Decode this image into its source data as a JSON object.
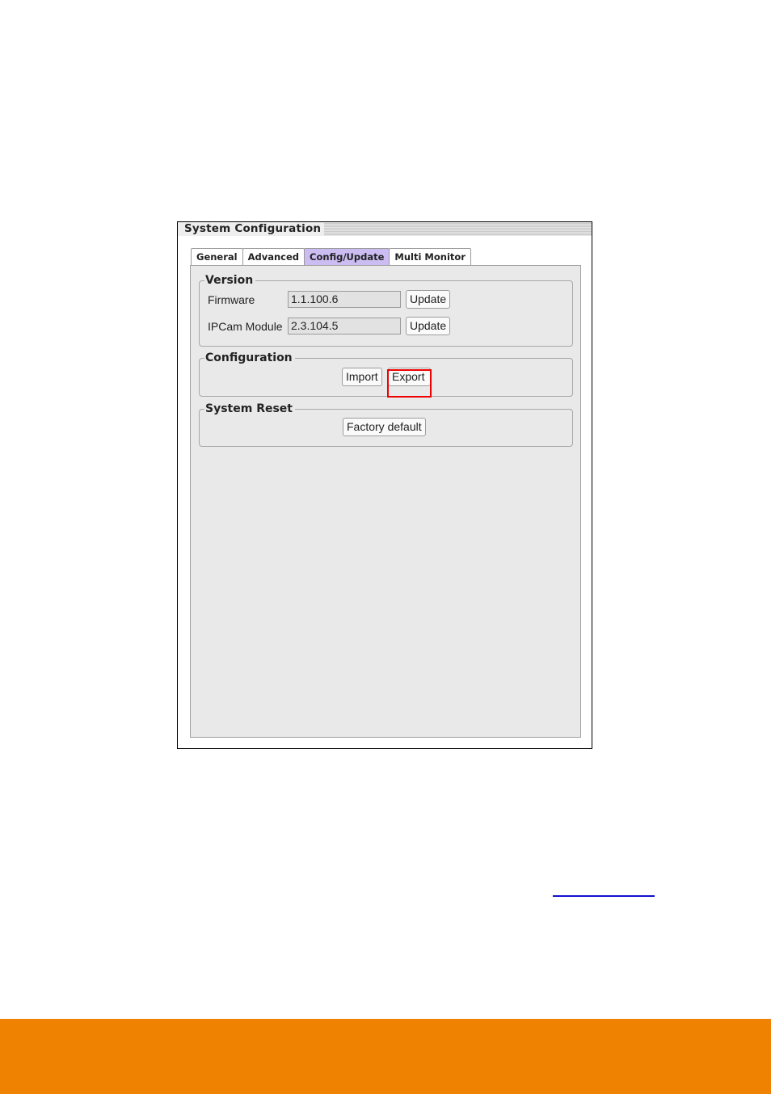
{
  "window": {
    "title": "System Configuration"
  },
  "tabs": [
    {
      "label": "General",
      "active": false
    },
    {
      "label": "Advanced",
      "active": false
    },
    {
      "label": "Config/Update",
      "active": true
    },
    {
      "label": "Multi Monitor",
      "active": false
    }
  ],
  "version": {
    "legend": "Version",
    "firmware": {
      "label": "Firmware",
      "value": "1.1.100.6",
      "button": "Update"
    },
    "ipcam": {
      "label": "IPCam Module",
      "value": "2.3.104.5",
      "button": "Update"
    }
  },
  "configuration": {
    "legend": "Configuration",
    "import_label": "Import",
    "export_label": "Export",
    "highlighted": "Export"
  },
  "system_reset": {
    "legend": "System Reset",
    "factory_default_label": "Factory default"
  },
  "colors": {
    "active_tab": "#cbbcf2",
    "highlight": "#ee0000",
    "footer": "#ef8200",
    "link": "#1010d0"
  }
}
